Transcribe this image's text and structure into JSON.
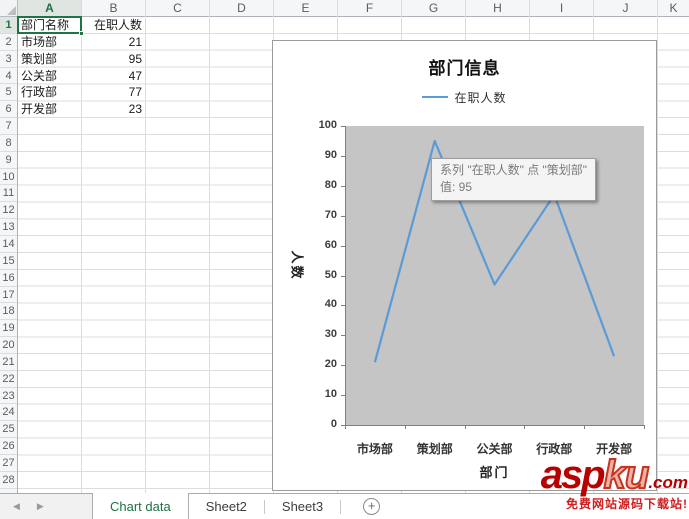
{
  "sheet": {
    "col_headers": [
      "A",
      "B",
      "C",
      "D",
      "E",
      "F",
      "G",
      "H",
      "I",
      "J",
      "K"
    ],
    "row_count": 28,
    "selected_cell": "A1",
    "rows": [
      {
        "a": "部门名称",
        "b": "在职人数"
      },
      {
        "a": "市场部",
        "b": "21"
      },
      {
        "a": "策划部",
        "b": "95"
      },
      {
        "a": "公关部",
        "b": "47"
      },
      {
        "a": "行政部",
        "b": "77"
      },
      {
        "a": "开发部",
        "b": "23"
      }
    ]
  },
  "chart_data": {
    "type": "line",
    "title": "部门信息",
    "categories": [
      "市场部",
      "策划部",
      "公关部",
      "行政部",
      "开发部"
    ],
    "series": [
      {
        "name": "在职人数",
        "values": [
          21,
          95,
          47,
          77,
          23
        ],
        "color": "#5b9bd5"
      }
    ],
    "xlabel": "部门",
    "ylabel": "人数",
    "ylim": [
      0,
      100
    ],
    "ytick_step": 10,
    "legend_position": "top",
    "plot_bg": "#c5c5c5",
    "grid": false
  },
  "tooltip": {
    "line1": "系列 \"在职人数\" 点 \"策划部\"",
    "line2": "值: 95"
  },
  "tabs": {
    "nav_prev": "◀",
    "nav_next": "▶",
    "items": [
      {
        "label": "Chart data",
        "active": true
      },
      {
        "label": "Sheet2",
        "active": false
      },
      {
        "label": "Sheet3",
        "active": false
      }
    ],
    "add": "+"
  },
  "watermark": {
    "brand_a": "asp",
    "brand_b": "ku",
    "brand_c": ".com",
    "tagline": "免费网站源码下载站!"
  }
}
